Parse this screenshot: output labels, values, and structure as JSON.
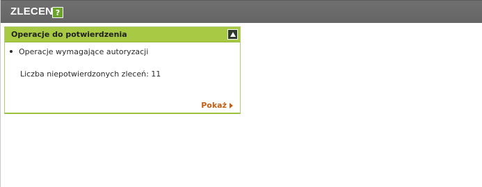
{
  "header": {
    "title": "ZLECENIA",
    "help_icon": "?"
  },
  "widget": {
    "title": "Operacje do potwierdzenia",
    "collapse_icon": "triangle-up-icon",
    "item_label": "Operacje wymagające autoryzacji",
    "count_label": "Liczba niepotwierdzonych zleceń: 11",
    "show_link": "Pokaż"
  },
  "colors": {
    "header_bg": "#666766",
    "widget_header_bg": "#a8c944",
    "link": "#c25f12",
    "help_bg": "#6aa22c"
  }
}
